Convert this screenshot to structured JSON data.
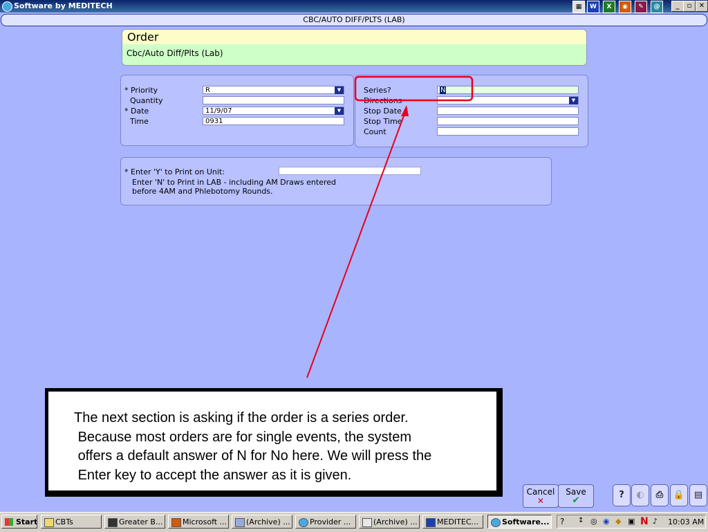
{
  "window": {
    "title": "Software by MEDITECH"
  },
  "header": {
    "title": "CBC/AUTO DIFF/PLTS (LAB)"
  },
  "order": {
    "heading": "Order",
    "name": "Cbc/Auto Diff/Plts (Lab)"
  },
  "left_form": {
    "priority_label": "* Priority",
    "priority_value": "R",
    "quantity_label": "Quantity",
    "quantity_value": "",
    "date_label": "* Date",
    "date_value": "11/9/07",
    "time_label": "Time",
    "time_value": "0931"
  },
  "right_form": {
    "series_label": "Series?",
    "series_value": "N",
    "directions_label": "Directions",
    "directions_value": "",
    "stop_date_label": "Stop Date",
    "stop_date_value": "",
    "stop_time_label": "Stop Time",
    "stop_time_value": "",
    "count_label": "Count",
    "count_value": ""
  },
  "print_panel": {
    "label": "* Enter 'Y' to Print on Unit:",
    "help_line1": "Enter 'N' to Print in LAB - including AM Draws entered",
    "help_line2": "before 4AM and Phlebotomy Rounds.",
    "value": ""
  },
  "callout": {
    "text": "The next section is asking if the order is a series order.\n Because most orders are for single events, the system\n offers a default answer of N for No here. We will press the\n Enter key to accept the answer as it is given."
  },
  "actions": {
    "cancel_label": "Cancel",
    "save_label": "Save"
  },
  "taskbar": {
    "start_label": "Start",
    "items": [
      "CBTs",
      "Greater B...",
      "Microsoft ...",
      "(Archive) ...",
      "Provider ...",
      "(Archive) ...",
      "MEDITEC...",
      "Software..."
    ],
    "clock": "10:03 AM"
  },
  "colors": {
    "background": "#a9b4ff",
    "callout_arrow": "#e8001c",
    "highlight_box": "#e8001c"
  }
}
